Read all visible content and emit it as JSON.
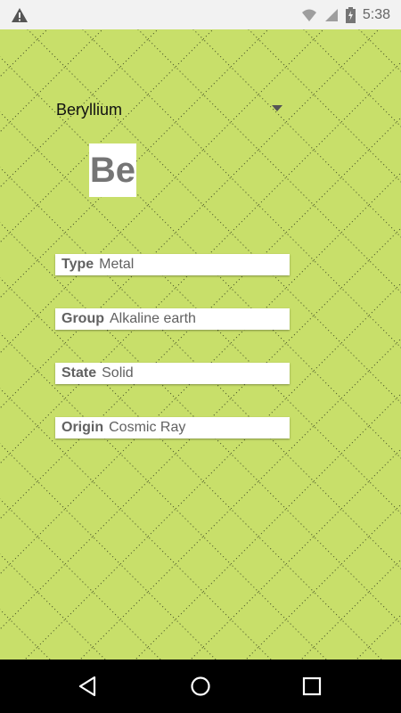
{
  "status_bar": {
    "time": "5:38",
    "icons": [
      "warning-icon",
      "wifi-icon",
      "signal-icon",
      "battery-icon"
    ]
  },
  "element_spinner": {
    "selected": "Beryllium"
  },
  "element": {
    "symbol": "Be",
    "fields": [
      {
        "label": "Type",
        "value": "Metal"
      },
      {
        "label": "Group",
        "value": "Alkaline earth"
      },
      {
        "label": "State",
        "value": "Solid"
      },
      {
        "label": "Origin",
        "value": "Cosmic Ray"
      }
    ]
  },
  "nav_bar": {
    "icons": [
      "back-icon",
      "home-icon",
      "recents-icon"
    ]
  },
  "colors": {
    "background": "#c8df6a",
    "status_bar": "#f2f2f2",
    "nav_bar": "#000000",
    "field_text": "#616161"
  }
}
